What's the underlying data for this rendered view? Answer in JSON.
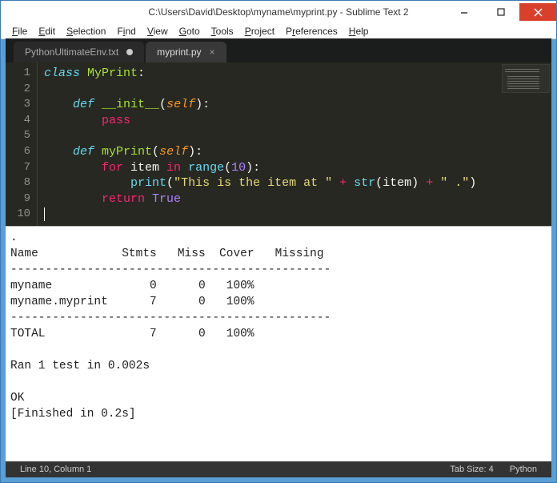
{
  "window": {
    "title": "C:\\Users\\David\\Desktop\\myname\\myprint.py - Sublime Text 2"
  },
  "menu": {
    "items": [
      "File",
      "Edit",
      "Selection",
      "Find",
      "View",
      "Goto",
      "Tools",
      "Project",
      "Preferences",
      "Help"
    ]
  },
  "tabs": [
    {
      "label": "PythonUltimateEnv.txt",
      "active": false,
      "dirty": true
    },
    {
      "label": "myprint.py",
      "active": true,
      "dirty": false
    }
  ],
  "editor": {
    "line_numbers": [
      "1",
      "2",
      "3",
      "4",
      "5",
      "6",
      "7",
      "8",
      "9",
      "10"
    ],
    "code": {
      "l1": {
        "class": "class ",
        "name": "MyPrint",
        "colon": ":"
      },
      "l2": "",
      "l3": {
        "def": "def ",
        "name": "__init__",
        "lp": "(",
        "self": "self",
        "rp": "):"
      },
      "l4": {
        "pass": "pass"
      },
      "l5": "",
      "l6": {
        "def": "def ",
        "name": "myPrint",
        "lp": "(",
        "self": "self",
        "rp": "):"
      },
      "l7": {
        "for": "for ",
        "item": "item ",
        "in": "in ",
        "range": "range",
        "lp": "(",
        "n": "10",
        "rp": "):"
      },
      "l8": {
        "print": "print",
        "lp": "(",
        "s1": "\"This is the item at \"",
        "plus1": " + ",
        "str": "str",
        "lp2": "(",
        "item": "item",
        "rp2": ")",
        "plus2": " + ",
        "s2": "\" .\"",
        "rp": ")"
      },
      "l9": {
        "return": "return ",
        "true": "True"
      }
    }
  },
  "console": {
    "text": ".\nName            Stmts   Miss  Cover   Missing\n----------------------------------------------\nmyname              0      0   100%\nmyname.myprint      7      0   100%\n----------------------------------------------\nTOTAL               7      0   100%\n\nRan 1 test in 0.002s\n\nOK\n[Finished in 0.2s]"
  },
  "status": {
    "left": "Line 10, Column 1",
    "tab_size": "Tab Size: 4",
    "syntax": "Python"
  }
}
